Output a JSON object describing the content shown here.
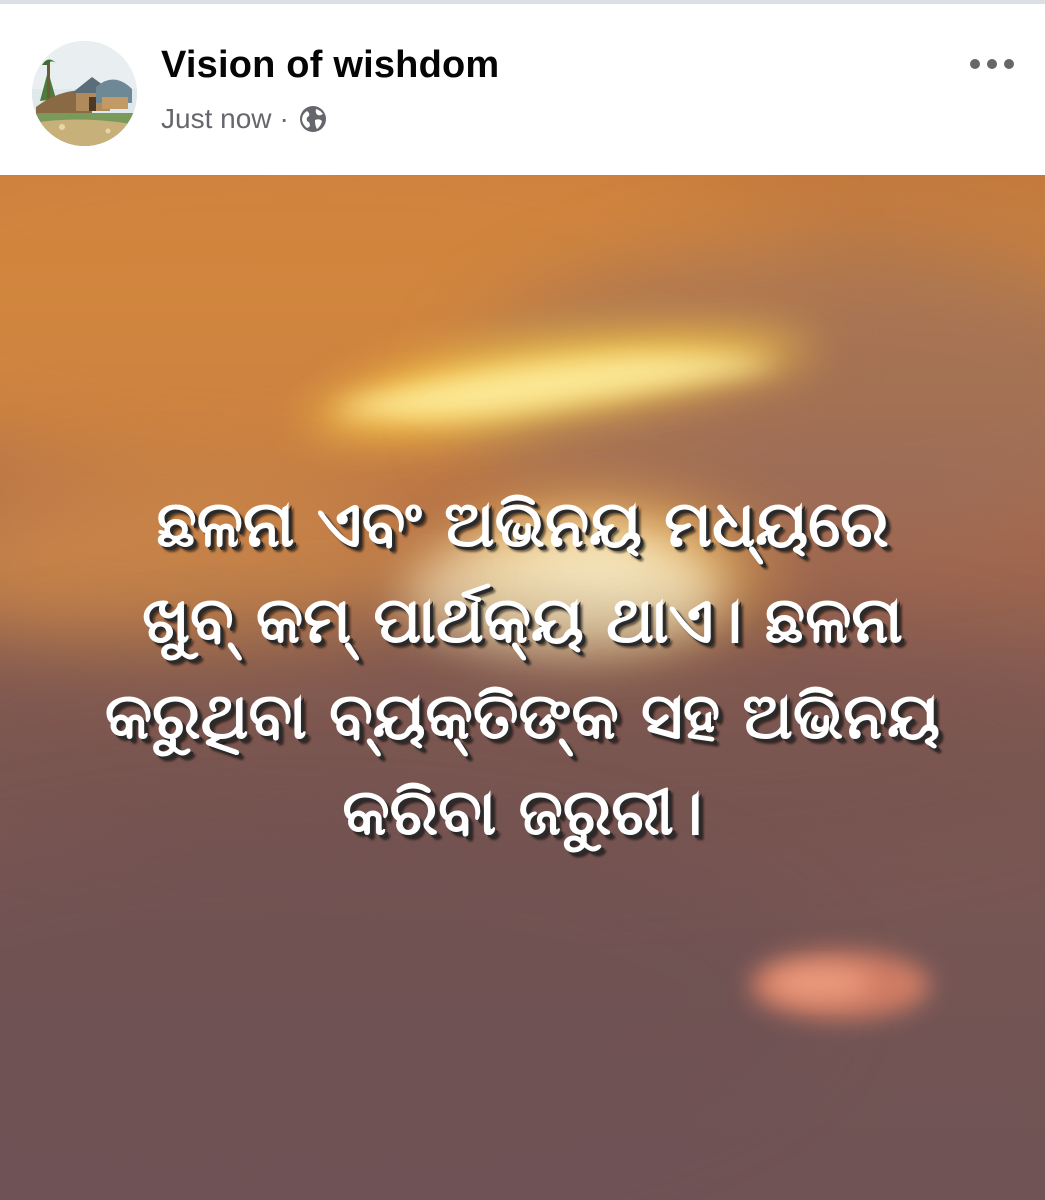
{
  "post": {
    "page_name": "Vision of wishdom",
    "timestamp": "Just now",
    "separator": "·",
    "audience_icon": "globe-icon",
    "more_icon": "more-options-icon"
  },
  "image": {
    "quote_lines": [
      "ଛଳନା ଏବଂ ଅଭିନୟ ମଧ୍ୟରେ",
      "ଖୁବ୍ କମ୍ ପାର୍ଥକ୍ୟ ଥାଏ। ଛଳନା",
      "କରୁଥିବା ବ୍ୟକ୍ତିଙ୍କ ସହ ଅଭିନୟ",
      "କରିବା ଜରୁରୀ।"
    ]
  },
  "colors": {
    "name_text": "#050505",
    "meta_text": "#65676b",
    "sky_top": "#c47a3e",
    "sky_bottom": "#6f5355"
  }
}
